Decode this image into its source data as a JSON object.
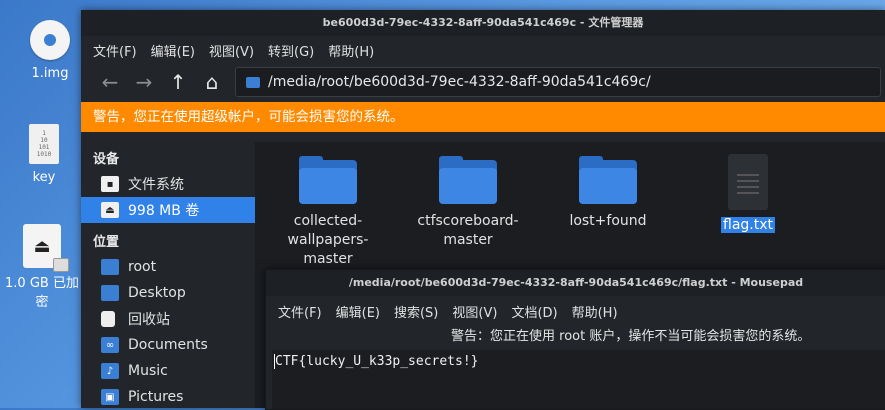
{
  "desktop": {
    "icons": [
      {
        "label": "1.img"
      },
      {
        "label": "key"
      },
      {
        "label": "1.0 GB 已加密"
      }
    ]
  },
  "file_manager": {
    "title": "be600d3d-79ec-4332-8aff-90da541c469c - 文件管理器",
    "menu": [
      "文件(F)",
      "编辑(E)",
      "视图(V)",
      "转到(G)",
      "帮助(H)"
    ],
    "path": "/media/root/be600d3d-79ec-4332-8aff-90da541c469c/",
    "warning": "警告，您正在使用超级帐户，可能会损害您的系统。",
    "sidebar": {
      "devices_header": "设备",
      "devices": [
        {
          "label": "文件系统",
          "icon": "drive-icon"
        },
        {
          "label": "998 MB 卷",
          "icon": "usb-drive-icon",
          "selected": true
        }
      ],
      "places_header": "位置",
      "places": [
        {
          "label": "root",
          "icon": "home-folder-icon"
        },
        {
          "label": "Desktop",
          "icon": "desktop-folder-icon"
        },
        {
          "label": "回收站",
          "icon": "trash-icon"
        },
        {
          "label": "Documents",
          "icon": "documents-folder-icon"
        },
        {
          "label": "Music",
          "icon": "music-folder-icon"
        },
        {
          "label": "Pictures",
          "icon": "pictures-folder-icon"
        }
      ]
    },
    "files": [
      {
        "name": "collected-wallpapers-master",
        "line1": "collected-",
        "line2": "wallpapers-master",
        "type": "folder"
      },
      {
        "name": "ctfscoreboard-master",
        "line1": "ctfscoreboard-",
        "line2": "master",
        "type": "folder"
      },
      {
        "name": "lost+found",
        "line1": "lost+found",
        "line2": "",
        "type": "folder"
      },
      {
        "name": "flag.txt",
        "line1": "flag.txt",
        "line2": "",
        "type": "text",
        "selected": true
      }
    ]
  },
  "mousepad": {
    "title": "/media/root/be600d3d-79ec-4332-8aff-90da541c469c/flag.txt - Mousepad",
    "menu": [
      "文件(F)",
      "编辑(E)",
      "搜索(S)",
      "视图(V)",
      "文档(D)",
      "帮助(H)"
    ],
    "warning": "警告：您正在使用 root 账户，操作不当可能会损害您的系统。",
    "content": "CTF{lucky_U_k33p_secrets!}"
  },
  "colors": {
    "accent": "#3081e8",
    "warning_bg": "#ff8a00",
    "window_bg": "#22262b"
  }
}
